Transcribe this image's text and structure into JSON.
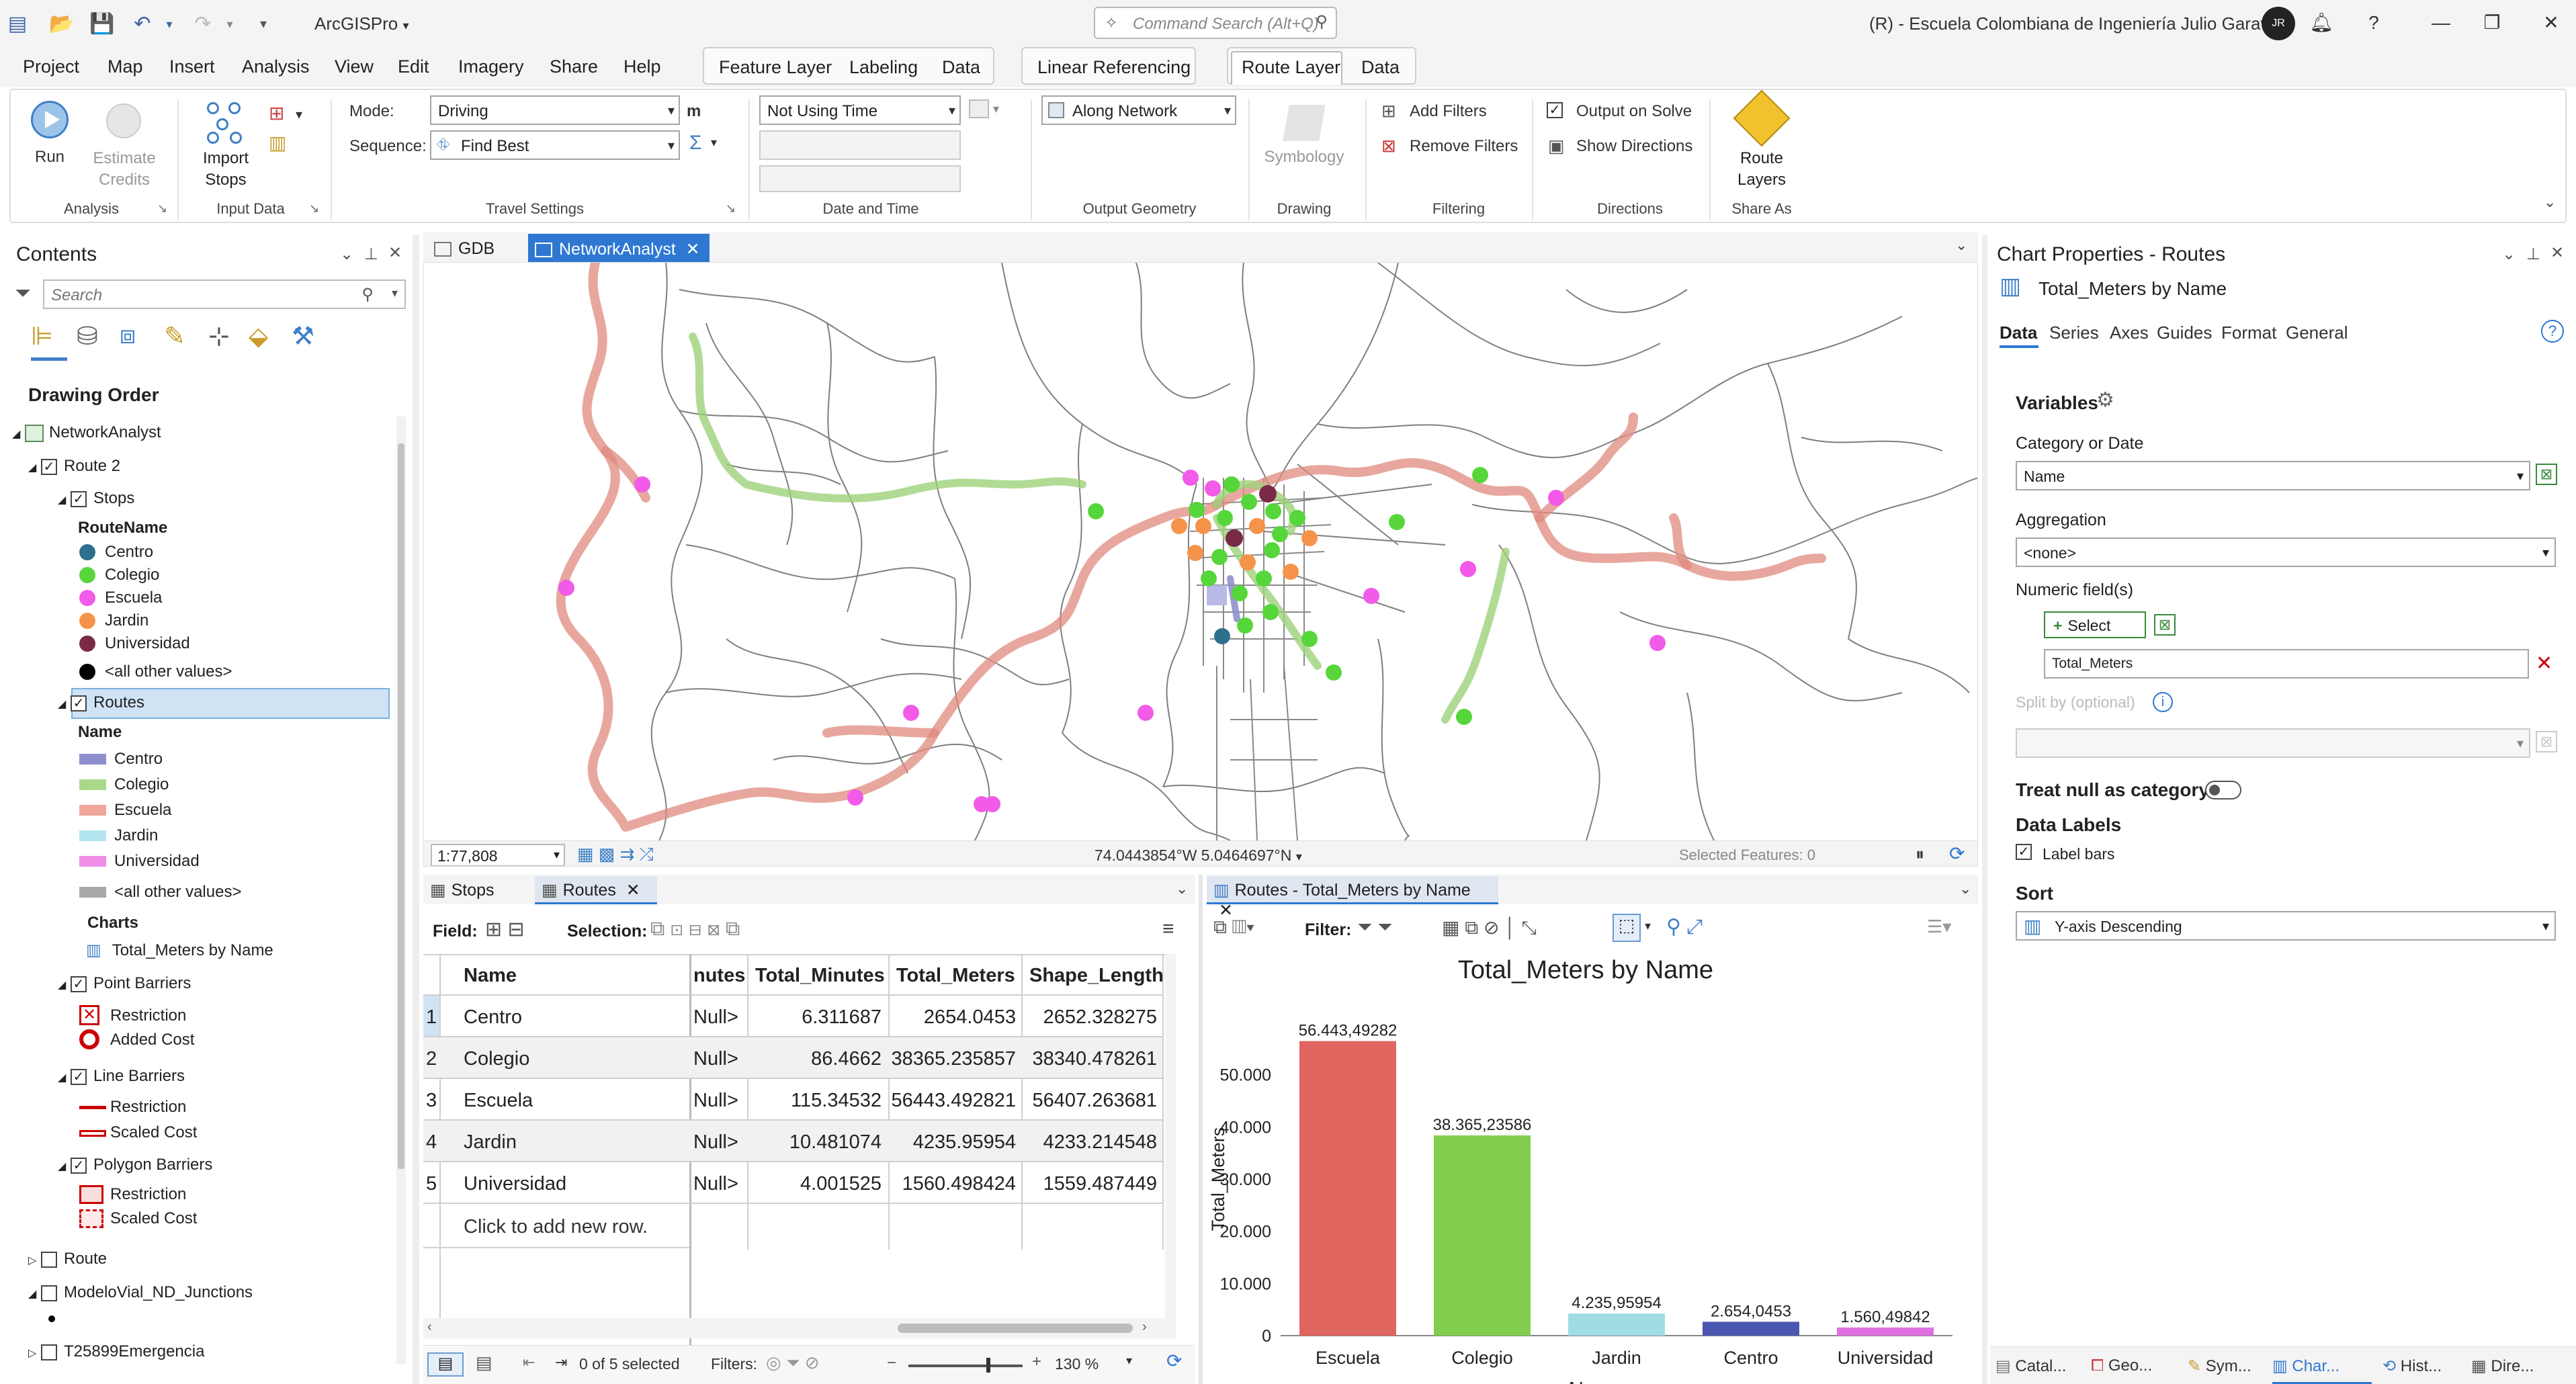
{
  "app": {
    "name": "ArcGISPro",
    "org": "(R) - Escuela Colombiana de Ingeniería Julio Garavito",
    "avatar": "JR",
    "command_search_placeholder": "Command Search (Alt+Q)"
  },
  "menu": {
    "items": [
      "Project",
      "Map",
      "Insert",
      "Analysis",
      "View",
      "Edit",
      "Imagery",
      "Share",
      "Help"
    ],
    "ctx1": [
      "Feature Layer",
      "Labeling",
      "Data"
    ],
    "ctx2": [
      "Linear Referencing"
    ],
    "ctx3": [
      "Route Layer",
      "Data"
    ]
  },
  "ribbon": {
    "run": "Run",
    "estimate_credits": "Estimate Credits",
    "import_stops": "Import Stops",
    "mode_label": "Mode:",
    "mode_value": "Driving",
    "mode_unit": "m",
    "sequence_label": "Sequence:",
    "sequence_value": "Find Best",
    "time_value": "Not Using Time",
    "geometry_value": "Along Network",
    "symbology": "Symbology",
    "add_filters": "Add Filters",
    "remove_filters": "Remove Filters",
    "output_on_solve": "Output on Solve",
    "show_directions": "Show Directions",
    "route_layers": "Route Layers",
    "groups": [
      "Analysis",
      "Input Data",
      "Travel Settings",
      "Date and Time",
      "Output Geometry",
      "Drawing",
      "Filtering",
      "Directions",
      "Share As"
    ]
  },
  "contents": {
    "title": "Contents",
    "search_placeholder": "Search",
    "drawing_order": "Drawing Order",
    "network": "NetworkAnalyst",
    "route2": "Route 2",
    "stops": "Stops",
    "route_name": "RouteName",
    "stop_classes": [
      {
        "label": "Centro",
        "color": "#2e6f8e"
      },
      {
        "label": "Colegio",
        "color": "#56d63a"
      },
      {
        "label": "Escuela",
        "color": "#f25ae8"
      },
      {
        "label": "Jardin",
        "color": "#f5934a"
      },
      {
        "label": "Universidad",
        "color": "#7a2a46"
      },
      {
        "label": "<all other values>",
        "color": "#000000"
      }
    ],
    "routes": "Routes",
    "name_header": "Name",
    "route_classes": [
      {
        "label": "Centro",
        "color": "#8f8fd0"
      },
      {
        "label": "Colegio",
        "color": "#a9d88a"
      },
      {
        "label": "Escuela",
        "color": "#f0a79c"
      },
      {
        "label": "Jardin",
        "color": "#b3e6ee"
      },
      {
        "label": "Universidad",
        "color": "#f08ee6"
      },
      {
        "label": "<all other values>",
        "color": "#a8a8a8"
      }
    ],
    "charts": "Charts",
    "chart_item": "Total_Meters by Name",
    "point_barriers": "Point Barriers",
    "restriction": "Restriction",
    "added_cost": "Added Cost",
    "line_barriers": "Line Barriers",
    "scaled_cost": "Scaled Cost",
    "polygon_barriers": "Polygon Barriers",
    "route": "Route",
    "junctions": "ModeloVial_ND_Junctions",
    "emergencia": "T25899Emergencia"
  },
  "map": {
    "tabs": [
      "GDB",
      "NetworkAnalyst"
    ],
    "scale": "1:77,808",
    "coords": "74.0443854°W 5.0464697°N",
    "selected": "Selected Features: 0"
  },
  "table": {
    "tabs": [
      "Stops",
      "Routes"
    ],
    "field_label": "Field:",
    "selection_label": "Selection:",
    "columns": [
      "Name",
      "nutes",
      "Total_Minutes",
      "Total_Meters",
      "Shape_Length"
    ],
    "rows": [
      [
        "1",
        "Centro",
        "Null>",
        "6.311687",
        "2654.0453",
        "2652.328275"
      ],
      [
        "2",
        "Colegio",
        "Null>",
        "86.4662",
        "38365.235857",
        "38340.478261"
      ],
      [
        "3",
        "Escuela",
        "Null>",
        "115.34532",
        "56443.492821",
        "56407.263681"
      ],
      [
        "4",
        "Jardin",
        "Null>",
        "10.481074",
        "4235.95954",
        "4233.214548"
      ],
      [
        "5",
        "Universidad",
        "Null>",
        "4.001525",
        "1560.498424",
        "1559.487449"
      ]
    ],
    "add_row": "Click to add new row.",
    "status": "0 of 5 selected",
    "filters": "Filters:",
    "zoom": "130 %"
  },
  "chart_panel": {
    "tab": "Routes - Total_Meters by Name",
    "filter_label": "Filter:"
  },
  "chart_data": {
    "type": "bar",
    "title": "Total_Meters by Name",
    "xlabel": "Name",
    "ylabel": "Total_Meters",
    "categories": [
      "Escuela",
      "Colegio",
      "Jardin",
      "Centro",
      "Universidad"
    ],
    "values": [
      56443.49282,
      38365.23586,
      4235.95954,
      2654.0453,
      1560.49842
    ],
    "labels": [
      "56.443,49282",
      "38.365,23586",
      "4.235,95954",
      "2.654,0453",
      "1.560,49842"
    ],
    "colors": [
      "#e0655e",
      "#82cc4e",
      "#9fdde3",
      "#4a56b0",
      "#e070e0"
    ],
    "ylim": [
      0,
      60000
    ],
    "yticks": [
      "0",
      "10.000",
      "20.000",
      "30.000",
      "40.000",
      "50.000"
    ]
  },
  "chart_props": {
    "title": "Chart Properties - Routes",
    "subtitle": "Total_Meters by Name",
    "tabs": [
      "Data",
      "Series",
      "Axes",
      "Guides",
      "Format",
      "General"
    ],
    "variables": "Variables",
    "category_label": "Category or Date",
    "category_value": "Name",
    "aggregation_label": "Aggregation",
    "aggregation_value": "<none>",
    "numeric_label": "Numeric field(s)",
    "select_button": "Select",
    "numeric_value": "Total_Meters",
    "split_label": "Split by (optional)",
    "treat_null": "Treat null as category",
    "data_labels": "Data Labels",
    "label_bars": "Label bars",
    "sort": "Sort",
    "sort_value": "Y-axis Descending"
  },
  "bottom_tabs": [
    "Catal...",
    "Geo...",
    "Sym...",
    "Char...",
    "Hist...",
    "Dire..."
  ]
}
